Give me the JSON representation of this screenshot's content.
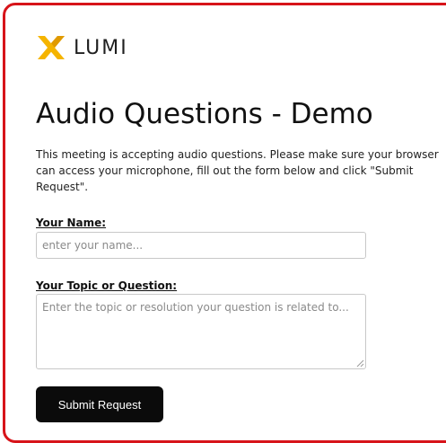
{
  "brand": {
    "name": "LUMI",
    "logo_icon": "lumi-x-icon",
    "accent_color": "#f5b400"
  },
  "page": {
    "title": "Audio Questions - Demo",
    "description": "This meeting is accepting audio questions. Please make sure your browser can access your microphone, fill out the form below and click \"Submit Request\"."
  },
  "form": {
    "name_label": "Your Name:",
    "name_placeholder": "enter your name...",
    "name_value": "",
    "topic_label": "Your Topic or Question:",
    "topic_placeholder": "Enter the topic or resolution your question is related to...",
    "topic_value": "",
    "submit_label": "Submit Request"
  },
  "colors": {
    "frame_border": "#d7141a",
    "button_bg": "#0b0b0b",
    "button_text": "#ffffff"
  }
}
